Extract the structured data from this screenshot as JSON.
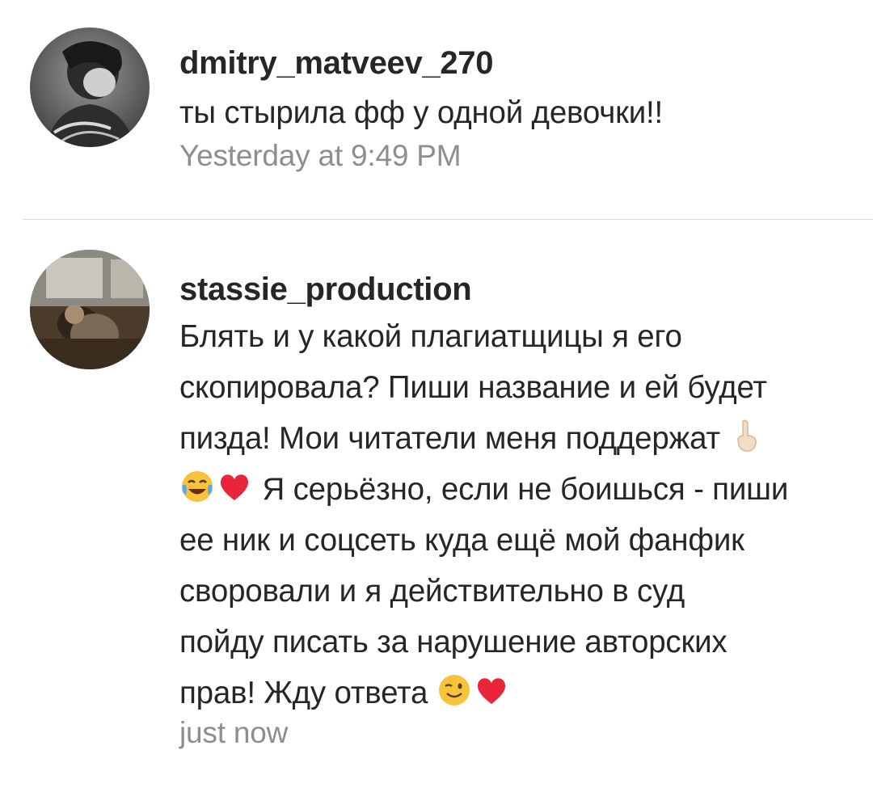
{
  "comments": [
    {
      "username": "dmitry_matveev_270",
      "text": "ты стырила фф у одной девочки!!",
      "time": "Yesterday at 9:49 PM",
      "avatar_icon": "dark-portrait-avatar"
    },
    {
      "username": "stassie_production",
      "text_lines": [
        "Блять и у какой плагиатщицы я его",
        "скопировала? Пиши название и ей будет",
        "пизда! Мои читатели меня поддержат",
        "Я серьёзно, если не боишься - пиши",
        "ее ник и соцсеть куда ещё мой фанфик",
        "своровали и я действительно в суд",
        "пойду писать за нарушение авторских",
        "прав! Жду ответа"
      ],
      "time": "just now",
      "avatar_icon": "train-interior-avatar",
      "emojis": [
        "index-pointing-up-emoji",
        "tears-of-joy-emoji",
        "red-heart-emoji",
        "winking-face-emoji",
        "red-heart-emoji"
      ]
    }
  ],
  "colors": {
    "text": "#262626",
    "meta": "#8e8e8e",
    "divider": "#dbdbdb",
    "heart": "#e8253a",
    "emoji_face": "#f7c33b"
  }
}
